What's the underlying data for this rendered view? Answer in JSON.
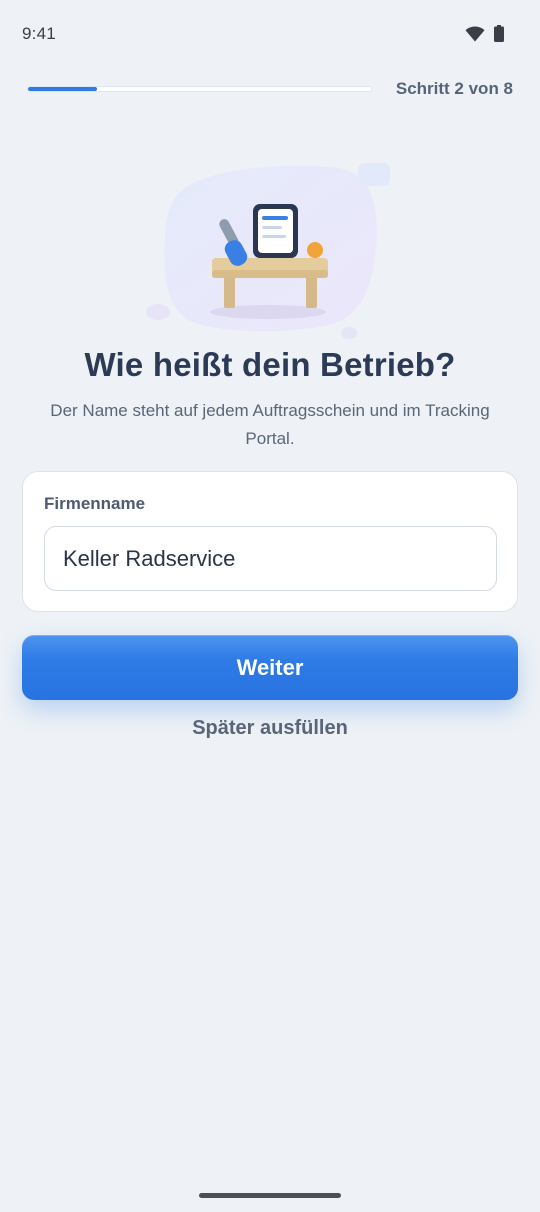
{
  "status_bar": {
    "time": "9:41",
    "icons": [
      "wifi-icon",
      "battery-icon"
    ]
  },
  "progress": {
    "step_label": "Schritt 2 von 8",
    "current_step": 2,
    "total_steps": 8,
    "fill_fraction": 0.2
  },
  "illustration": {
    "icon": "desk-with-document-illustration"
  },
  "heading": {
    "title": "Wie heißt dein Betrieb?",
    "subtitle": "Der Name steht auf jedem Auftragsschein und im Tracking Portal."
  },
  "form": {
    "field_label": "Firmenname",
    "field_value": "Keller Radservice",
    "field_placeholder": ""
  },
  "actions": {
    "primary_label": "Weiter",
    "secondary_label": "Später ausfüllen"
  },
  "colors": {
    "background": "#eef2f6",
    "accent": "#2f7be6",
    "title_text": "#2d3a56",
    "muted_text": "#5a6578"
  }
}
